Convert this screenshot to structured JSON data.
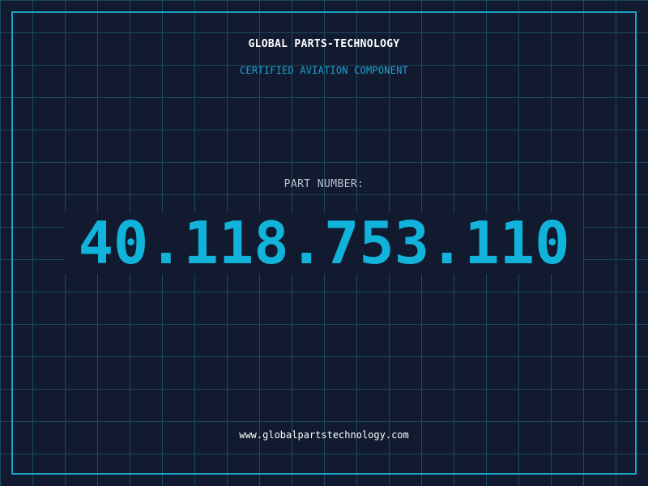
{
  "header": {
    "company": "GLOBAL PARTS-TECHNOLOGY",
    "tagline": "CERTIFIED AVIATION COMPONENT"
  },
  "part": {
    "label": "PART NUMBER:",
    "number": "40.118.753.110"
  },
  "footer": {
    "website": "www.globalpartstechnology.com"
  },
  "colors": {
    "background": "#111a2e",
    "grid": "#1d4a5e",
    "frame": "#1aa3c8",
    "accent": "#12b3da"
  }
}
